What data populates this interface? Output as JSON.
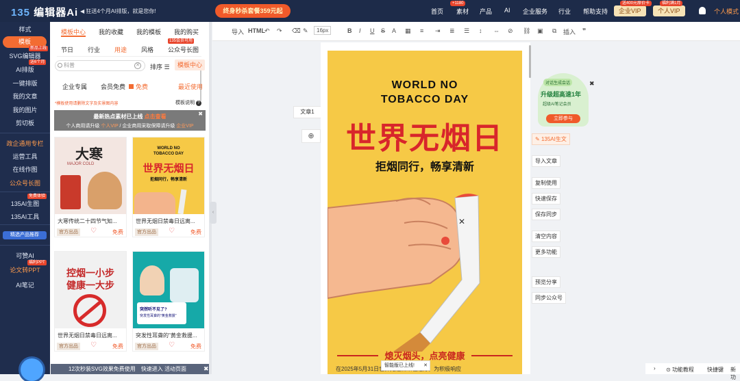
{
  "header": {
    "logo_mark": "135",
    "logo_text": "编辑器Ai",
    "slogan": "狂送4个月AI排版，就是您你!",
    "promo": "终身秒杀套餐359元起",
    "nav": [
      "首页",
      "素材",
      "产品",
      "AI",
      "企业服务",
      "行业",
      "帮助支持"
    ],
    "nav_badge": "+1180",
    "enterprise_vip": "企业VIP",
    "enterprise_badge": "送400元原价卡",
    "personal_vip": "个人VIP",
    "personal_badge": "福利满1月",
    "personal_mode": "个人模式"
  },
  "sidebar": {
    "items": [
      {
        "label": "样式"
      },
      {
        "label": "模板"
      },
      {
        "label": "SVG编辑器",
        "badge": "新品上线"
      },
      {
        "label": "AI排版",
        "badge": "送6个月"
      },
      {
        "label": "一键排版"
      },
      {
        "label": "我的文章"
      },
      {
        "label": "我的图片"
      },
      {
        "label": "剪切板"
      },
      {
        "label": "政企通用专栏"
      },
      {
        "label": "运营工具"
      },
      {
        "label": "在线作图"
      },
      {
        "label": "公众号长图"
      },
      {
        "label": "135AI生图",
        "badge": "免费体验"
      },
      {
        "label": "135AI工具"
      },
      {
        "label": "精选产品推荐"
      },
      {
        "label": "可赞AI"
      },
      {
        "label": "论文转PPT",
        "badge": "福利PPT"
      },
      {
        "label": "AI笔记"
      }
    ]
  },
  "template_panel": {
    "tabs": [
      "模板中心",
      "我的收藏",
      "我的模板",
      "我的购买"
    ],
    "subtabs": [
      "节日",
      "行业",
      "用途",
      "风格",
      "公众号长图"
    ],
    "subtab_badge": "135会员可用",
    "search_placeholder": "科普",
    "sort_label": "排序",
    "center_label": "模板中心",
    "filters": [
      "企业专属",
      "会员免费",
      "免费"
    ],
    "recent": "最近使用",
    "hint": "*模板使用请删除文字及实景图内容",
    "guide": "模板说明",
    "notice_title": "最新热点素材已上线",
    "notice_link": "点击查看",
    "notice_body": "个人商用请升级",
    "notice_vip": "个人VIP",
    "notice_mid": "/ 企业商用采取保障请升级",
    "notice_vip2": "企业VIP",
    "cards": [
      {
        "title": "大寒传统二十四节气知...",
        "tag": "官方出品",
        "price": "免费"
      },
      {
        "title": "世界无烟日禁毒日远离...",
        "tag": "官方出品",
        "price": "免费"
      },
      {
        "title": "世界无烟日禁毒日远离...",
        "tag": "官方出品",
        "price": "免费"
      },
      {
        "title": "突发性耳聋的\"黄金救援...",
        "tag": "官方出品",
        "price": "免费"
      }
    ],
    "thumb1_big": "大寒",
    "thumb1_sub": "MAJOR COLD",
    "thumb3_a": "控烟一小步",
    "thumb3_b": "健康一大步",
    "thumb4_a": "突然听不见了?",
    "thumb4_b": "突发性耳聋的\"黄金救援\"",
    "bottom_banner": "12次秒装SVG效果免费使用",
    "bottom_banner2": "快速进入 活动页面"
  },
  "toolbar": {
    "import": "导入",
    "html": "HTML",
    "fontsize": "16px",
    "insert": "插入"
  },
  "editor": {
    "doc_label": "文章1",
    "poster_en1": "WORLD NO",
    "poster_en2": "TOBACCO DAY",
    "poster_title": "世界无烟日",
    "poster_sub": "拒烟同行，畅享清新",
    "poster_slogan": "熄灭烟头，点亮健康",
    "poster_body": "在2025年5月31日世界无烟日来临之际，为积极响应",
    "toast": "智能版已上线!"
  },
  "right_panel": {
    "ad_top": "对话生成会话",
    "ad_main": "升级超高速1年",
    "ad_sub": "超级AI笔记会员",
    "ad_btn": "立即参与",
    "ai_btn": "135AI生文",
    "buttons": [
      "导入文章",
      "复制使用",
      "快速保存",
      "保存同步",
      "清空内容",
      "更多功能",
      "预览分享",
      "同步公众号"
    ]
  },
  "bottombar": {
    "tutorial": "功能教程",
    "shortcut": "快捷键",
    "new": "新功"
  }
}
